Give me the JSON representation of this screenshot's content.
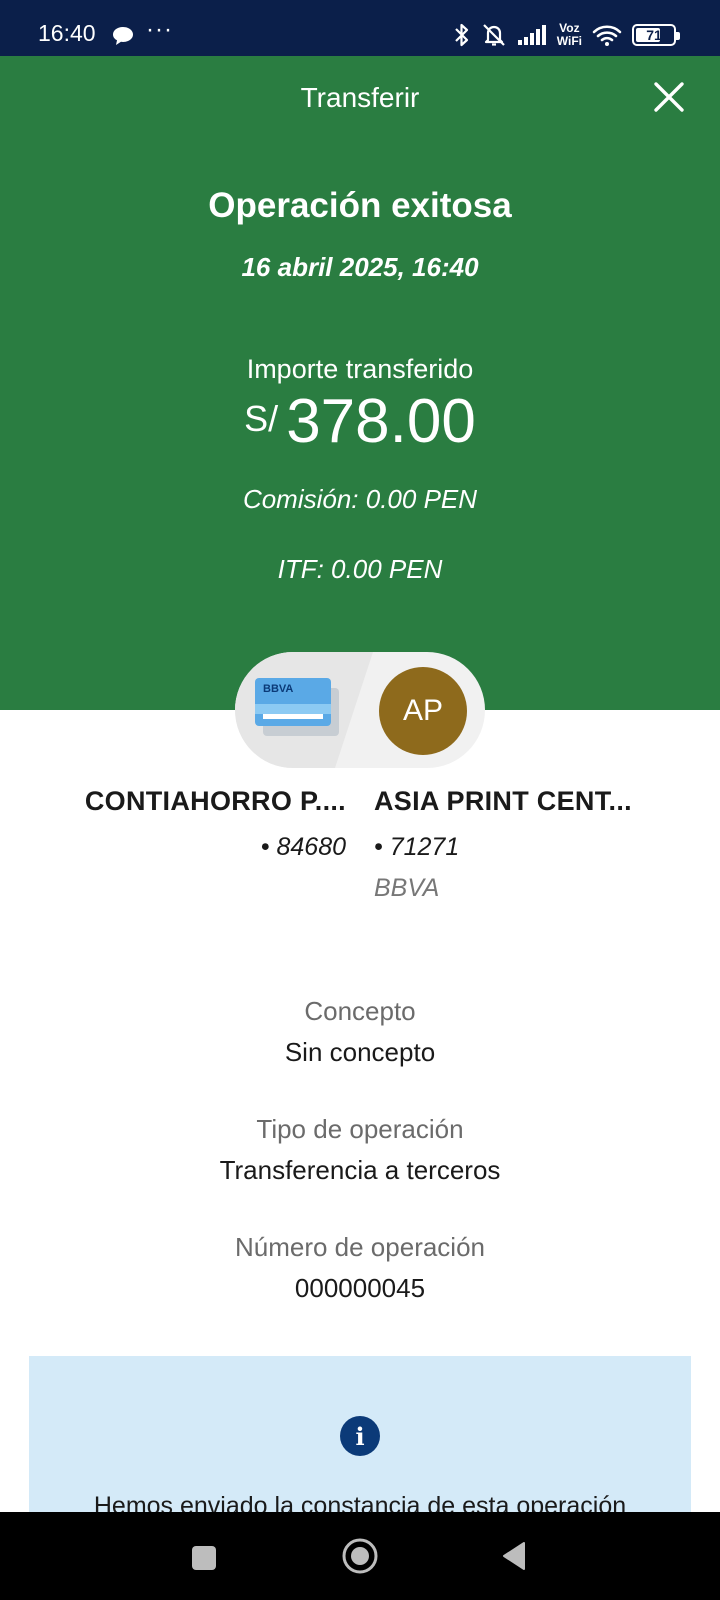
{
  "status_bar": {
    "time": "16:40",
    "more": "···",
    "voz_top": "Voz",
    "voz_bottom": "WiFi",
    "battery": "71",
    "battery_level": 0.71
  },
  "header": {
    "title": "Transferir",
    "close_icon": "close-icon"
  },
  "result": {
    "title": "Operación exitosa",
    "date": "16 abril 2025, 16:40",
    "amount_label": "Importe transferido",
    "currency": "S/",
    "amount": "378.00",
    "commission": "Comisión: 0.00 PEN",
    "itf": "ITF: 0.00 PEN"
  },
  "transfer": {
    "card_label": "BBVA",
    "avatar_initials": "AP",
    "origin": {
      "name": "CONTIAHORRO P....",
      "number": "• 84680"
    },
    "destination": {
      "name": "ASIA PRINT CENT...",
      "number": "• 71271",
      "bank": "BBVA"
    }
  },
  "details": [
    {
      "label": "Concepto",
      "value": "Sin concepto"
    },
    {
      "label": "Tipo de operación",
      "value": "Transferencia a terceros"
    },
    {
      "label": "Número de operación",
      "value": "000000045"
    }
  ],
  "info": {
    "icon": "info-icon",
    "icon_glyph": "i",
    "text": "Hemos enviado la constancia de esta operación"
  },
  "colors": {
    "status_bar": "#0b1f4a",
    "hero_green": "#2a7d41",
    "avatar": "#8e6a1c",
    "info_bg": "#d4eaf8",
    "info_icon": "#0b3a78"
  }
}
